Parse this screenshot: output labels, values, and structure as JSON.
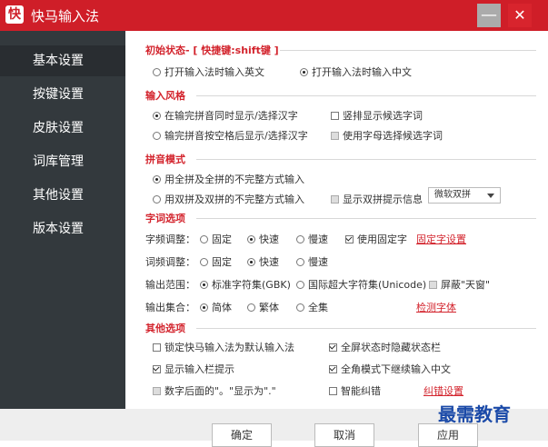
{
  "window": {
    "logo_char": "快",
    "title": "快马输入法",
    "minimize_glyph": "—",
    "close_glyph": "✕"
  },
  "sidebar": {
    "items": [
      {
        "label": "基本设置",
        "active": true
      },
      {
        "label": "按键设置"
      },
      {
        "label": "皮肤设置"
      },
      {
        "label": "词库管理"
      },
      {
        "label": "其他设置"
      },
      {
        "label": "版本设置"
      }
    ]
  },
  "initial_state": {
    "title": "初始状态- [ 快捷键:shift键 ]",
    "opt_english": "打开输入法时输入英文",
    "opt_chinese": "打开输入法时输入中文"
  },
  "input_style": {
    "title": "输入风格",
    "opt_same_time": "在输完拼音同时显示/选择汉字",
    "opt_vertical": "竖排显示候选字词",
    "opt_after_space": "输完拼音按空格后显示/选择汉字",
    "opt_letters": "使用字母选择候选字词"
  },
  "pinyin_mode": {
    "title": "拼音模式",
    "opt_full": "用全拼及全拼的不完整方式输入",
    "opt_double": "用双拼及双拼的不完整方式输入",
    "opt_show_double": "显示双拼提示信息",
    "double_scheme": "微软双拼"
  },
  "word_options": {
    "title": "字词选项",
    "char_freq_label": "字频调整：",
    "word_freq_label": "词频调整：",
    "fixed": "固定",
    "fast": "快速",
    "slow": "慢速",
    "use_fixed_char": "使用固定字",
    "fixed_char_link": "固定字设置",
    "output_range_label": "输出范围：",
    "range_gbk": "标准字符集(GBK)",
    "range_unicode": "国际超大字符集(Unicode)",
    "block_tianchuang": "屏蔽\"天窗\"",
    "output_set_label": "输出集合：",
    "simplified": "简体",
    "traditional": "繁体",
    "full_set": "全集",
    "detect_font_link": "检测字体"
  },
  "other_options": {
    "title": "其他选项",
    "lock_default": "锁定快马输入法为默认输入法",
    "hide_status_bar": "全屏状态时隐藏状态栏",
    "show_input_hint": "显示输入栏提示",
    "fullwidth_continue": "全角模式下继续输入中文",
    "digit_after": "数字后面的\"。\"显示为\".\"",
    "smart_correct": "智能纠错",
    "correct_link": "纠错设置"
  },
  "buttons": {
    "ok": "确定",
    "cancel": "取消",
    "apply": "应用"
  },
  "watermark": "最需教育"
}
